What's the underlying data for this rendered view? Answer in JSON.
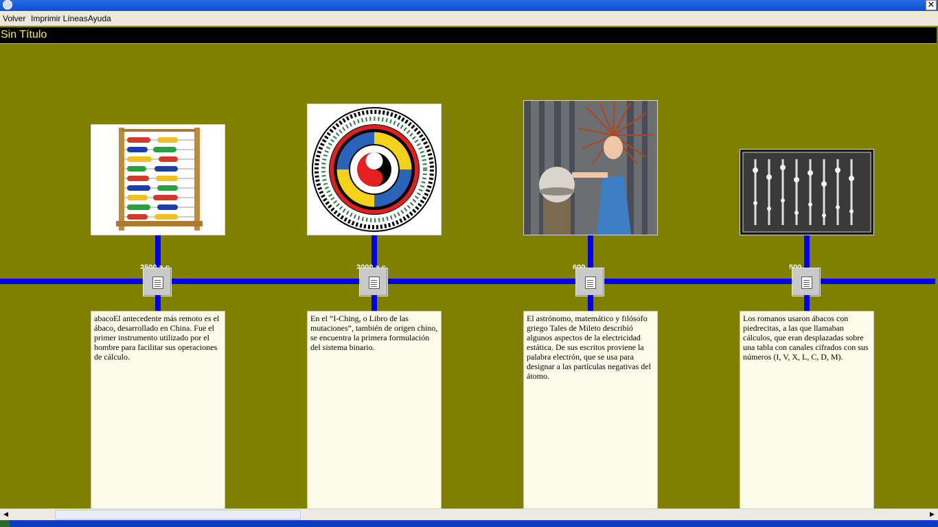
{
  "menubar": {
    "items": [
      "Volver",
      "Imprimir Líneas",
      "Ayuda"
    ]
  },
  "document": {
    "title": "Sin Título"
  },
  "titlebar": {
    "close_label": "✕"
  },
  "events": [
    {
      "year": "2500 a.c",
      "image": "abacus-photo",
      "description": "abacoEl antecedente más remoto es el ábaco, desarrollado en China. Fue el primer instrumento utilizado por el hombre para facilitar sus operaciones de cálculo."
    },
    {
      "year": "2000 a.c",
      "image": "i-ching-wheel",
      "description": "En el “I-Ching, o Libro de las mutaciones”, también de origen chino, se encuentra la primera formulación del sistema binario."
    },
    {
      "year": "600",
      "image": "static-electricity-girl",
      "description": "El astrónomo, matemático y filósofo griego Tales de Mileto describió algunos aspectos de la electricidad estática. De sus escritos proviene la palabra electrón, que se usa para designar a las partículas negativas del átomo."
    },
    {
      "year": "500",
      "image": "roman-abacus",
      "description": "Los romanos usaron ábacos con piedrecitas, a las que llamaban cálculos, que eran desplazadas sobre una tabla con canales cifrados con sus números (I, V, X, L, C, D, M)."
    }
  ],
  "colors": {
    "background": "#7f7f00",
    "axis": "#0000ee",
    "title_text": "#ffe84d"
  }
}
